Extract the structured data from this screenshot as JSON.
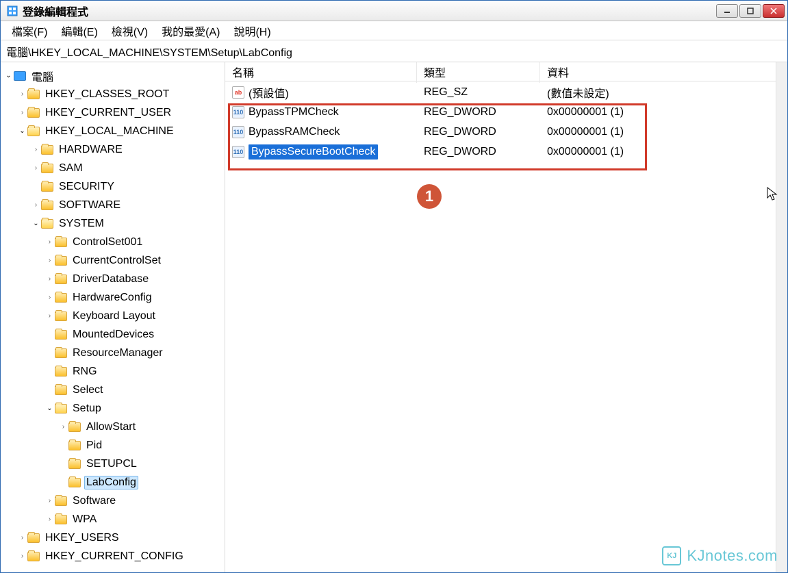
{
  "title": "登錄編輯程式",
  "menu": [
    "檔案(F)",
    "編輯(E)",
    "檢視(V)",
    "我的最愛(A)",
    "說明(H)"
  ],
  "path": "電腦\\HKEY_LOCAL_MACHINE\\SYSTEM\\Setup\\LabConfig",
  "columns": {
    "name": "名稱",
    "type": "類型",
    "data": "資料"
  },
  "tree": {
    "root": {
      "label": "電腦",
      "icon": "computer",
      "expanded": true
    },
    "hives": [
      {
        "label": "HKEY_CLASSES_ROOT",
        "expandable": true
      },
      {
        "label": "HKEY_CURRENT_USER",
        "expandable": true
      },
      {
        "label": "HKEY_LOCAL_MACHINE",
        "expandable": true,
        "expanded": true,
        "children": [
          {
            "label": "HARDWARE",
            "expandable": true
          },
          {
            "label": "SAM",
            "expandable": true
          },
          {
            "label": "SECURITY"
          },
          {
            "label": "SOFTWARE",
            "expandable": true
          },
          {
            "label": "SYSTEM",
            "expandable": true,
            "expanded": true,
            "children": [
              {
                "label": "ControlSet001",
                "expandable": true
              },
              {
                "label": "CurrentControlSet",
                "expandable": true
              },
              {
                "label": "DriverDatabase",
                "expandable": true
              },
              {
                "label": "HardwareConfig",
                "expandable": true
              },
              {
                "label": "Keyboard Layout",
                "expandable": true
              },
              {
                "label": "MountedDevices"
              },
              {
                "label": "ResourceManager"
              },
              {
                "label": "RNG"
              },
              {
                "label": "Select"
              },
              {
                "label": "Setup",
                "expandable": true,
                "expanded": true,
                "children": [
                  {
                    "label": "AllowStart",
                    "expandable": true
                  },
                  {
                    "label": "Pid"
                  },
                  {
                    "label": "SETUPCL"
                  },
                  {
                    "label": "LabConfig",
                    "selected": true
                  }
                ]
              },
              {
                "label": "Software",
                "expandable": true
              },
              {
                "label": "WPA",
                "expandable": true
              }
            ]
          }
        ]
      },
      {
        "label": "HKEY_USERS",
        "expandable": true
      },
      {
        "label": "HKEY_CURRENT_CONFIG",
        "expandable": true
      }
    ]
  },
  "values": [
    {
      "name": "(預設值)",
      "type": "REG_SZ",
      "data": "(數值未設定)",
      "icon": "sz"
    },
    {
      "name": "BypassTPMCheck",
      "type": "REG_DWORD",
      "data": "0x00000001 (1)",
      "icon": "dw"
    },
    {
      "name": "BypassRAMCheck",
      "type": "REG_DWORD",
      "data": "0x00000001 (1)",
      "icon": "dw"
    },
    {
      "name": "BypassSecureBootCheck",
      "type": "REG_DWORD",
      "data": "0x00000001 (1)",
      "icon": "dw",
      "selected": true
    }
  ],
  "annotation": {
    "number": "1"
  },
  "watermark": {
    "icon": "KJ",
    "text": "KJnotes.com"
  }
}
